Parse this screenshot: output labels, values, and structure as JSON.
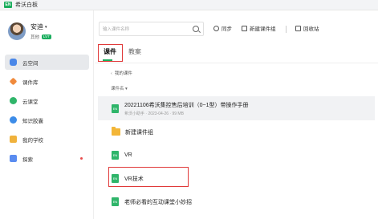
{
  "app": {
    "title": "希沃白板",
    "logo_text": "EN"
  },
  "user": {
    "name": "安迪",
    "dropdown": "▾",
    "subject": "其他",
    "badge": "LV7"
  },
  "nav": [
    {
      "label": "云空间",
      "icon": "cloud-icon",
      "active": true
    },
    {
      "label": "课件库",
      "icon": "library-icon"
    },
    {
      "label": "云课堂",
      "icon": "classroom-icon"
    },
    {
      "label": "知识胶囊",
      "icon": "knowledge-icon"
    },
    {
      "label": "我的学校",
      "icon": "school-icon"
    },
    {
      "label": "探索",
      "icon": "explore-icon",
      "dot": true
    }
  ],
  "toolbar": {
    "search_placeholder": "输入课件名称",
    "sync": "同步",
    "new_group": "新建课件组",
    "recycle": "回收站"
  },
  "tabs": {
    "courseware": "课件",
    "lesson_plan": "教案"
  },
  "breadcrumb": "我的课件",
  "sort": "课件名 ▾",
  "items": [
    {
      "type": "file",
      "title": "20221106希沃集控售后培训（0~1型）带操作手册",
      "meta": "希沃小助手 · 2023-04-26 · 99 MB"
    },
    {
      "type": "folder",
      "title": "新建课件组"
    },
    {
      "type": "file",
      "title": "VR"
    },
    {
      "type": "file",
      "title": "VR技术"
    },
    {
      "type": "file",
      "title": "老师必看的互动课堂小妙招"
    }
  ],
  "colors": {
    "accent": "#1aad5d",
    "highlight": "#e03a3a"
  }
}
